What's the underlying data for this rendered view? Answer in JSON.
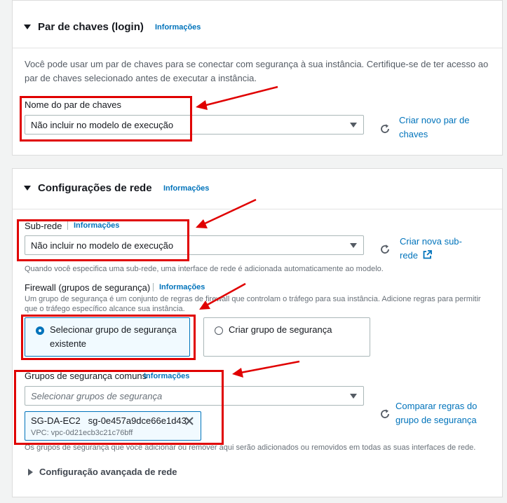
{
  "keypair_section": {
    "title": "Par de chaves (login)",
    "info": "Informações",
    "description": "Você pode usar um par de chaves para se conectar com segurança à sua instância. Certifique-se de ter acesso ao par de chaves selecionado antes de executar a instância.",
    "field_label": "Nome do par de chaves",
    "select_value": "Não incluir no modelo de execução",
    "create_link_line1": "Criar novo par de",
    "create_link_line2": "chaves"
  },
  "network_section": {
    "title": "Configurações de rede",
    "info": "Informações",
    "subnet": {
      "label": "Sub-rede",
      "info": "Informações",
      "value": "Não incluir no modelo de execução",
      "create_link_line1": "Criar nova sub-",
      "create_link_line2": "rede",
      "help": "Quando você especifica uma sub-rede, uma interface de rede é adicionada automaticamente ao modelo."
    },
    "firewall": {
      "label": "Firewall (grupos de segurança)",
      "info": "Informações",
      "description": "Um grupo de segurança é um conjunto de regras de firewall que controlam o tráfego para sua instância. Adicione regras para permitir que o tráfego específico alcance sua instância.",
      "option_select_line1": "Selecionar grupo de segurança",
      "option_select_line2": "existente",
      "option_create": "Criar grupo de segurança",
      "selected": "select_existing"
    },
    "common_sg": {
      "label": "Grupos de segurança comuns",
      "info": "Informações",
      "placeholder": "Selecionar grupos de segurança",
      "token_name": "SG-DA-EC2",
      "token_id": "sg-0e457a9dce66e1d43",
      "token_vpc": "VPC: vpc-0d21ecb3c21c76bff",
      "compare_line1": "Comparar regras do",
      "compare_line2": "grupo de segurança",
      "help": "Os grupos de segurança que você adicionar ou remover aqui serão adicionados ou removidos em todas as suas interfaces de rede."
    },
    "advanced": "Configuração avançada de rede"
  },
  "colors": {
    "link": "#0073bb",
    "annotation": "#e00000"
  }
}
